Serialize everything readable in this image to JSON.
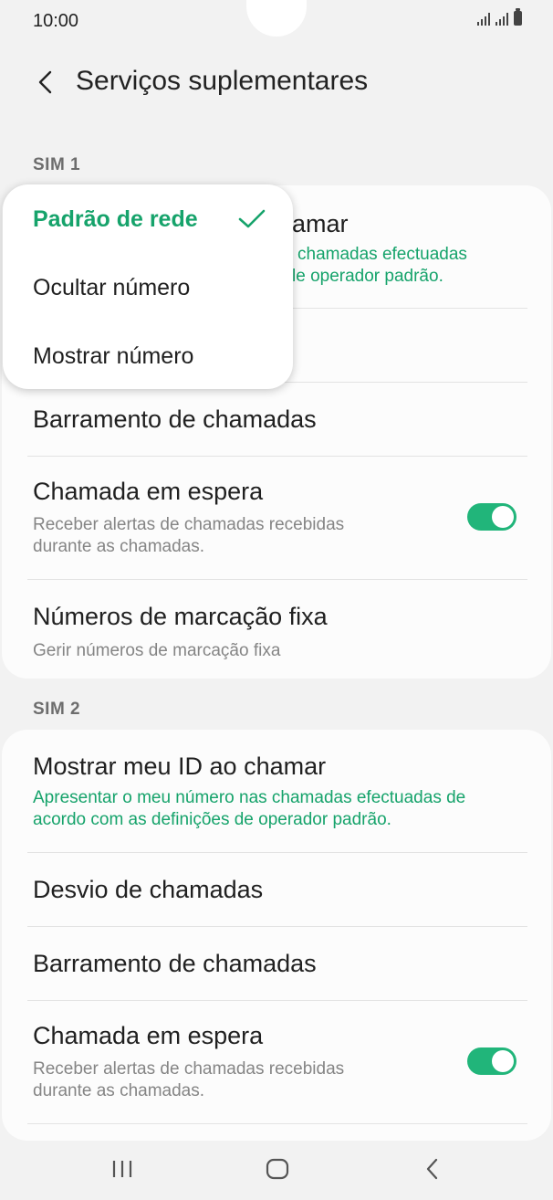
{
  "status_bar": {
    "time": "10:00"
  },
  "header": {
    "title": "Serviços suplementares"
  },
  "sim1": {
    "label": "SIM 1",
    "partial_title": "amar",
    "partial_sub_line1": "chamadas efectuadas",
    "partial_sub_line2": "le operador padrão.",
    "barring": "Barramento de chamadas",
    "waiting_title": "Chamada em espera",
    "waiting_sub": "Receber alertas de chamadas recebidas durante as chamadas.",
    "waiting_on": true,
    "fdn_title": "Números de marcação fixa",
    "fdn_sub": "Gerir números de marcação fixa"
  },
  "popup": {
    "items": [
      {
        "label": "Padrão de rede",
        "selected": true
      },
      {
        "label": "Ocultar número",
        "selected": false
      },
      {
        "label": "Mostrar número",
        "selected": false
      }
    ]
  },
  "sim2": {
    "label": "SIM 2",
    "caller_id_title": "Mostrar meu ID ao chamar",
    "caller_id_sub": "Apresentar o meu número nas chamadas efectuadas de acordo com as definições de operador padrão.",
    "forwarding": "Desvio de chamadas",
    "barring": "Barramento de chamadas",
    "waiting_title": "Chamada em espera",
    "waiting_sub": "Receber alertas de chamadas recebidas durante as chamadas.",
    "waiting_on": true
  },
  "colors": {
    "accent": "#16a36b",
    "toggle_on": "#21b57a",
    "background": "#f2f2f2"
  }
}
